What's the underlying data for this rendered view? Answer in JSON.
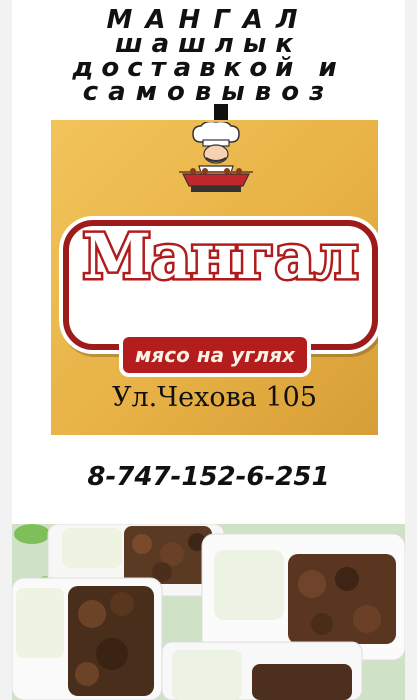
{
  "headline": {
    "line1": "МАНГАЛ",
    "line2": "шашлык",
    "line3": "доставкой и",
    "line4": "самовывоз"
  },
  "sign": {
    "brand": "Мангал",
    "tagline": "мясо на углях",
    "address": "Ул.Чехова 105",
    "colors": {
      "background": "#e8b246",
      "accent": "#b01b1b"
    }
  },
  "contact": {
    "phone": "8-747-152-6-251"
  },
  "photos": {
    "food_icon": "food-containers-photo"
  }
}
